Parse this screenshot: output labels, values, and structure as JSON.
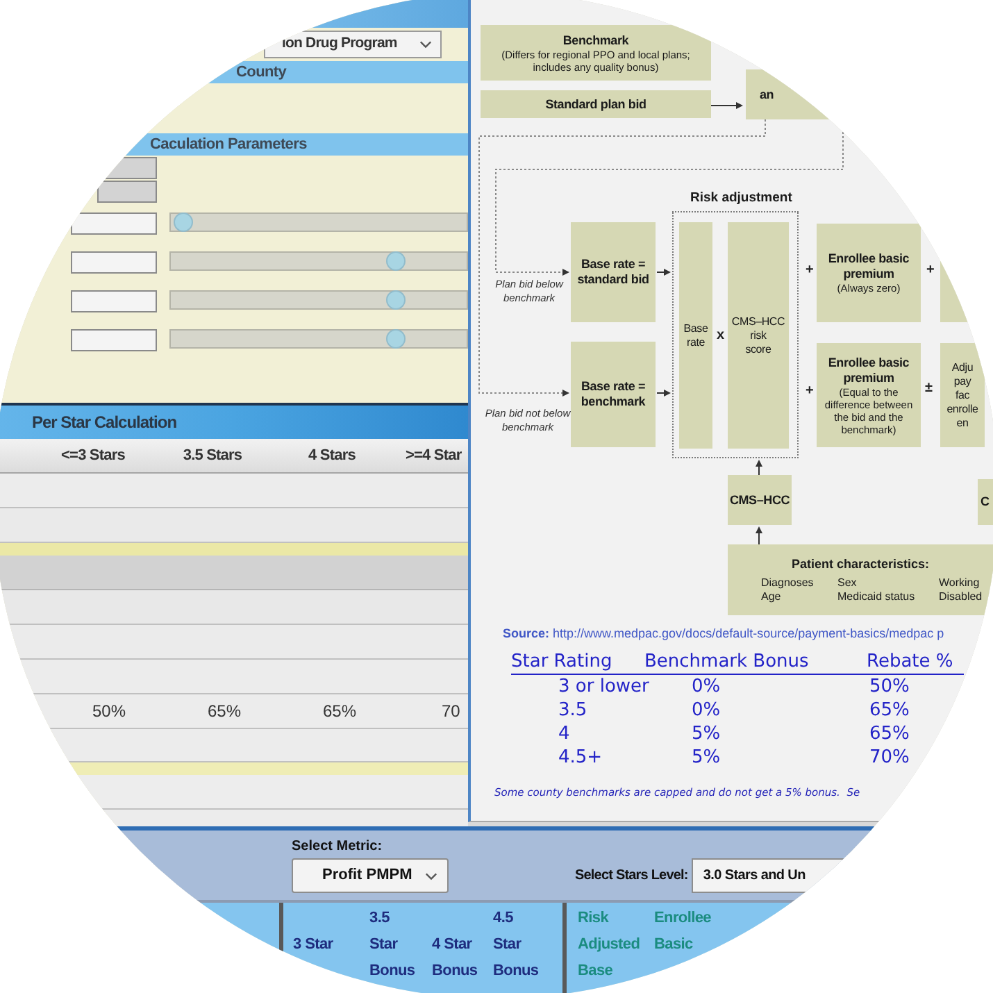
{
  "dashboard": {
    "program_select": {
      "value": "ion Drug Program"
    },
    "county_header": "County",
    "parameters": {
      "title": "Caculation Parameters",
      "rows": [
        {
          "kind": "readonly"
        },
        {
          "kind": "readonly"
        },
        {
          "kind": "slider",
          "level": 0.01
        },
        {
          "kind": "slider",
          "level": 0.78
        },
        {
          "kind": "slider",
          "level": 0.78
        },
        {
          "kind": "slider",
          "level": 0.78
        }
      ]
    },
    "per_star": {
      "title": "Per Star Calculation",
      "columns": [
        "<=3 Stars",
        "3.5 Stars",
        "4 Stars",
        ">=4 Star"
      ],
      "rebate_values": [
        "50%",
        "65%",
        "65%",
        "70"
      ]
    }
  },
  "figure": {
    "risk_label": "Risk adjustment",
    "nodes": [
      {
        "kind": "titled",
        "title": "Benchmark",
        "detail": "(Differs for regional PPO and local plans; includes any quality bonus)"
      },
      {
        "kind": "titled",
        "title": "Standard plan bid"
      },
      {
        "kind": "titled",
        "title": "an"
      },
      {
        "kind": "titled",
        "title": "Base rate = standard bid"
      },
      {
        "kind": "plain",
        "text": "Base rate"
      },
      {
        "kind": "plain",
        "text": "CMS–HCC risk score"
      },
      {
        "kind": "titled",
        "title": "Enrollee basic premium",
        "detail": "(Always zero)"
      },
      {
        "kind": "blank"
      },
      {
        "kind": "titled",
        "title": "Base rate = benchmark"
      },
      {
        "kind": "titled",
        "title": "Enrollee basic premium",
        "detail": "(Equal to the difference between the bid and the benchmark)"
      },
      {
        "kind": "plain",
        "text": "Adju pay fac enrolle en"
      },
      {
        "kind": "titled",
        "title": "CMS–HCC"
      },
      {
        "kind": "titled",
        "title": "C"
      },
      {
        "kind": "list",
        "title": "Patient characteristics:",
        "items": [
          "Diagnoses",
          "Sex",
          "Working",
          "Age",
          "Medicaid status",
          "Disabled"
        ]
      }
    ],
    "path_labels": [
      "Plan bid below benchmark",
      "Plan bid not below benchmark"
    ],
    "operators": [
      "+",
      "+",
      "x",
      "+",
      "±"
    ],
    "source": "**Source:** http://www.medpac.gov/docs/default-source/payment-basics/medpac p",
    "rating_table": {
      "columns": [
        "Star Rating",
        "Benchmark Bonus",
        "Rebate %"
      ],
      "rows": [
        [
          "3 or lower",
          "0%",
          "50%"
        ],
        [
          "3.5",
          "0%",
          "65%"
        ],
        [
          "4",
          "5%",
          "65%"
        ],
        [
          "4.5+",
          "5%",
          "70%"
        ]
      ]
    },
    "note": "Some county benchmarks are capped and do not get a 5% bonus.  Se"
  },
  "controls": {
    "metric": {
      "label": "Select Metric:",
      "value": "Profit PMPM"
    },
    "stars_level": {
      "label": "Select Stars Level:",
      "value": "3.0 Stars and Un"
    }
  },
  "summary_columns": [
    {
      "lines": [
        "3 Star"
      ]
    },
    {
      "lines": [
        "3.5",
        "Star",
        "Bonus"
      ]
    },
    {
      "lines": [
        "4 Star",
        "Bonus"
      ]
    },
    {
      "lines": [
        "4.5",
        "Star",
        "Bonus"
      ]
    }
  ],
  "adjustment_columns": [
    {
      "lines": [
        "Risk",
        "Adjusted",
        "Base"
      ]
    },
    {
      "lines": [
        "Enrollee",
        "Basic"
      ]
    }
  ]
}
